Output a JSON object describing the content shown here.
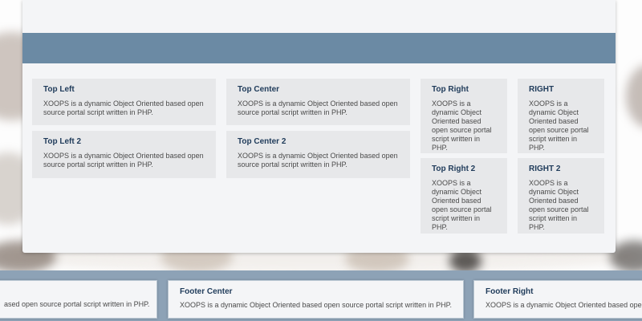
{
  "blocks": {
    "top_left": {
      "title": "Top Left",
      "text": "XOOPS is a dynamic Object Oriented based open source portal script written in PHP."
    },
    "top_left_2": {
      "title": "Top Left 2",
      "text": "XOOPS is a dynamic Object Oriented based open source portal script written in PHP."
    },
    "top_center": {
      "title": "Top Center",
      "text": "XOOPS is a dynamic Object Oriented based open source portal script written in PHP."
    },
    "top_center_2": {
      "title": "Top Center 2",
      "text": "XOOPS is a dynamic Object Oriented based open source portal script written in PHP."
    },
    "top_right": {
      "title": "Top Right",
      "text": "XOOPS is a dynamic Object Oriented based open source portal script written in PHP."
    },
    "top_right_2": {
      "title": "Top Right 2",
      "text": "XOOPS is a dynamic Object Oriented based open source portal script written in PHP."
    },
    "right": {
      "title": "RIGHT",
      "text": "XOOPS is a dynamic Object Oriented based open source portal script written in PHP."
    },
    "right_2": {
      "title": "RIGHT 2",
      "text": "XOOPS is a dynamic Object Oriented based open source portal script written in PHP."
    }
  },
  "footer": {
    "left": {
      "text": "ased open source portal script written in PHP."
    },
    "center": {
      "title": "Footer Center",
      "text": "XOOPS is a dynamic Object Oriented based open source portal script written in PHP."
    },
    "right": {
      "title": "Footer Right",
      "text": "XOOPS is a dynamic Object Oriented based open"
    }
  },
  "colors": {
    "nav_band": "#6b8aa4",
    "footer_bar": "#8da2b6",
    "title": "#1f3b5a"
  }
}
